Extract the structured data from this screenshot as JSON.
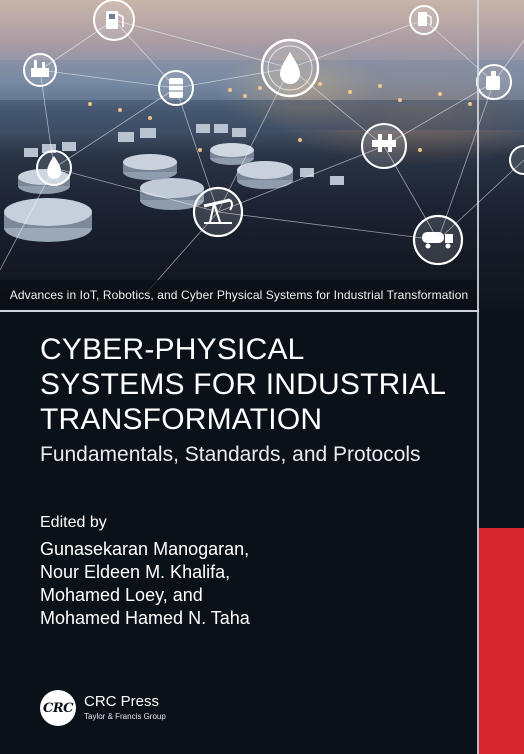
{
  "series": "Advances in IoT, Robotics, and Cyber Physical Systems for Industrial Transformation",
  "title_lines": [
    "CYBER-PHYSICAL",
    "SYSTEMS FOR INDUSTRIAL",
    "TRANSFORMATION"
  ],
  "subtitle": "Fundamentals, Standards, and Protocols",
  "edited_by": "Edited by",
  "editors": [
    "Gunasekaran Manogaran,",
    "Nour Eldeen M. Khalifa,",
    "Mohamed Loey, and",
    "Mohamed Hamed N. Taha"
  ],
  "publisher": {
    "logo": "CRC",
    "name": "CRC Press",
    "group": "Taylor & Francis Group"
  },
  "colors": {
    "background": "#0b1119",
    "accent_red": "#d8262e",
    "text": "#ffffff"
  },
  "icons": [
    "fuel-pump-icon",
    "gas-station-icon",
    "refinery-icon",
    "oil-drop-icon",
    "oil-can-icon",
    "flame-icon",
    "pipeline-icon",
    "pump-jack-icon",
    "tanker-truck-icon"
  ]
}
